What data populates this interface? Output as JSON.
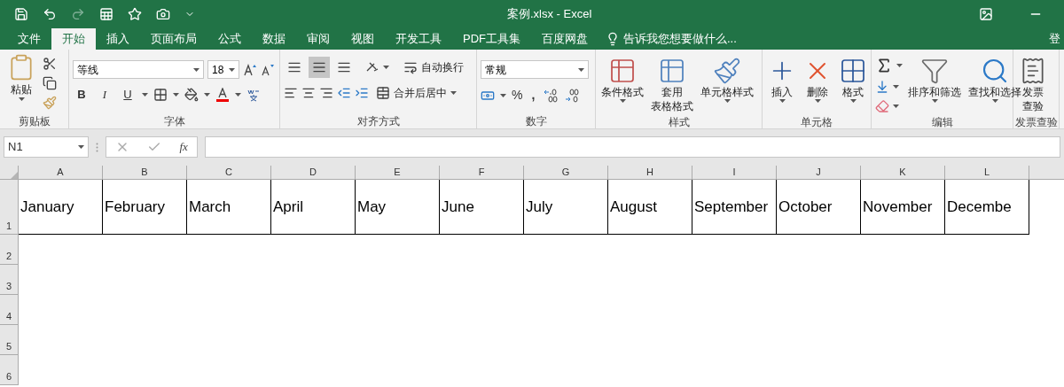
{
  "window": {
    "title": "案例.xlsx - Excel"
  },
  "tabs": [
    {
      "label": "文件",
      "selected": false
    },
    {
      "label": "开始",
      "selected": true
    },
    {
      "label": "插入",
      "selected": false
    },
    {
      "label": "页面布局",
      "selected": false
    },
    {
      "label": "公式",
      "selected": false
    },
    {
      "label": "数据",
      "selected": false
    },
    {
      "label": "审阅",
      "selected": false
    },
    {
      "label": "视图",
      "selected": false
    },
    {
      "label": "开发工具",
      "selected": false
    },
    {
      "label": "PDF工具集",
      "selected": false
    },
    {
      "label": "百度网盘",
      "selected": false
    }
  ],
  "tell_me": "告诉我您想要做什么...",
  "account": "登",
  "clipboard": {
    "label": "剪贴板",
    "paste": "粘贴"
  },
  "font": {
    "label": "字体",
    "name": "等线",
    "size": "18",
    "bold": "B",
    "italic": "I",
    "underline": "U"
  },
  "alignment": {
    "label": "对齐方式",
    "vertical": [
      {
        "selected": false
      },
      {
        "selected": true
      },
      {
        "selected": false
      }
    ],
    "wrap": "自动换行",
    "merge": "合并后居中"
  },
  "number": {
    "label": "数字",
    "format": "常规",
    "percent": "%",
    "comma": ","
  },
  "styles": {
    "label": "样式",
    "buttons": [
      {
        "kind": "conditional",
        "lines": [
          "条件格式"
        ]
      },
      {
        "kind": "table",
        "lines": [
          "套用",
          "表格格式"
        ]
      },
      {
        "kind": "cellstyle",
        "lines": [
          "单元格样式"
        ]
      }
    ]
  },
  "cells": {
    "label": "单元格",
    "buttons": [
      {
        "kind": "insert",
        "lines": [
          "插入"
        ]
      },
      {
        "kind": "delete",
        "lines": [
          "删除"
        ]
      },
      {
        "kind": "format",
        "lines": [
          "格式"
        ]
      }
    ]
  },
  "editing": {
    "label": "编辑",
    "buttons": [
      {
        "kind": "sort",
        "lines": [
          "排序和筛选"
        ]
      },
      {
        "kind": "find",
        "lines": [
          "查找和选择"
        ]
      }
    ]
  },
  "invoice": {
    "label": "发票查验",
    "buttons": [
      {
        "kind": "invoice",
        "lines": [
          "发票",
          "查验"
        ]
      }
    ]
  },
  "formula_bar": {
    "name_box": "N1",
    "fx": "fx"
  },
  "sheet": {
    "columns": [
      "A",
      "B",
      "C",
      "D",
      "E",
      "F",
      "G",
      "H",
      "I",
      "J",
      "K",
      "L"
    ],
    "rows": [
      {
        "header": "1",
        "cells": [
          "January",
          "February",
          "March",
          "April",
          "May",
          "June",
          "July",
          "August",
          "September",
          "October",
          "November",
          "Decembe"
        ]
      },
      {
        "header": "2"
      },
      {
        "header": "3"
      },
      {
        "header": "4"
      },
      {
        "header": "5"
      },
      {
        "header": "6"
      }
    ]
  }
}
